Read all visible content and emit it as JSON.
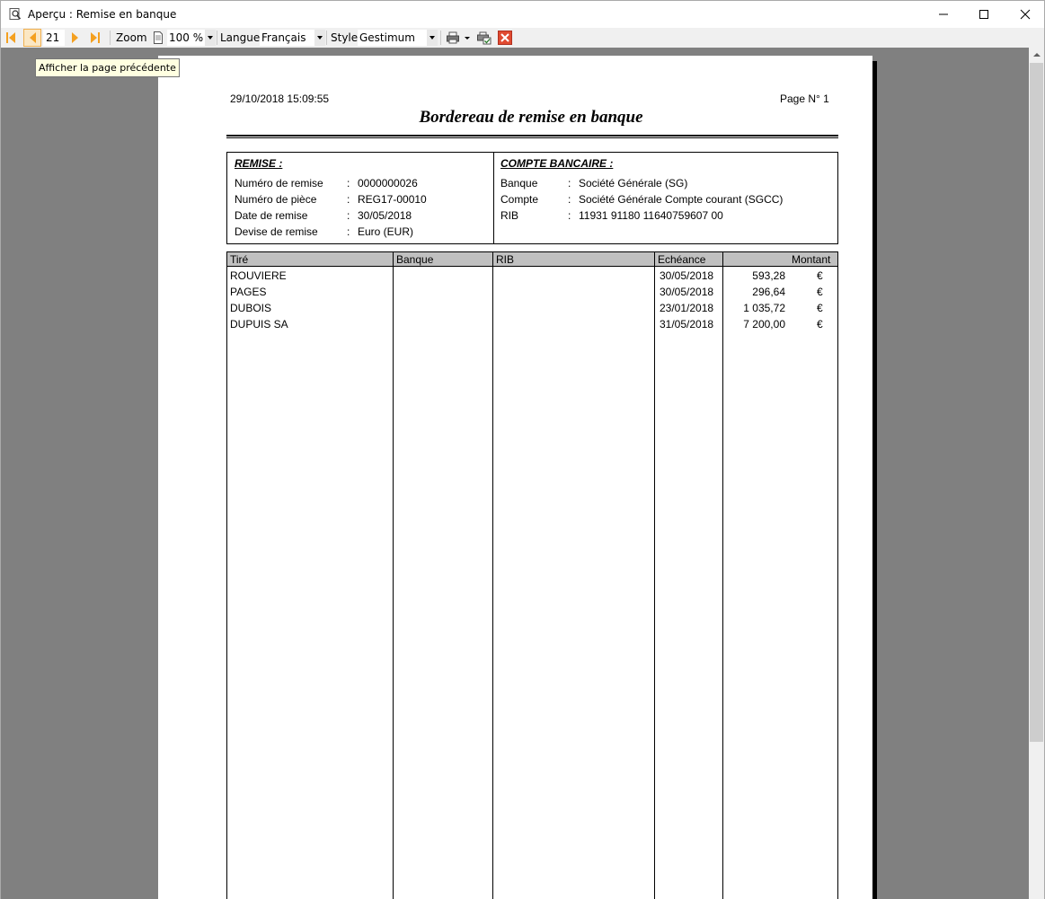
{
  "window": {
    "title": "Aperçu : Remise en banque",
    "tooltip": "Afficher la page précédente"
  },
  "toolbar": {
    "page_number": "21",
    "zoom_label": "Zoom",
    "zoom_value": "100 %",
    "language_label": "Langue",
    "language_value": "Français",
    "style_label": "Style",
    "style_value": "Gestimum"
  },
  "document": {
    "datetime": "29/10/2018 15:09:55",
    "page_label": "Page N° 1",
    "title": "Bordereau de remise en banque",
    "remise": {
      "heading": "REMISE :",
      "rows": [
        {
          "label": "Numéro de remise",
          "sep": ":",
          "value": "0000000026"
        },
        {
          "label": "Numéro de pièce",
          "sep": ":",
          "value": "REG17-00010"
        },
        {
          "label": "Date de remise",
          "sep": ":",
          "value": "30/05/2018"
        },
        {
          "label": "Devise de remise",
          "sep": ":",
          "value": "Euro (EUR)"
        }
      ]
    },
    "compte": {
      "heading": "COMPTE BANCAIRE :",
      "rows": [
        {
          "label": "Banque",
          "sep": ":",
          "value": "Société Générale (SG)"
        },
        {
          "label": "Compte",
          "sep": ":",
          "value": "Société Générale Compte courant (SGCC)"
        },
        {
          "label": "RIB",
          "sep": ":",
          "value": "11931 91180 11640759607 00"
        }
      ]
    },
    "table": {
      "columns": [
        "Tiré",
        "Banque",
        "RIB",
        "Echéance",
        "Montant"
      ],
      "rows": [
        {
          "tire": "ROUVIERE",
          "banque": "",
          "rib": "",
          "echeance": "30/05/2018",
          "montant": "593,28",
          "currency": "€"
        },
        {
          "tire": "PAGES",
          "banque": "",
          "rib": "",
          "echeance": "30/05/2018",
          "montant": "296,64",
          "currency": "€"
        },
        {
          "tire": "DUBOIS",
          "banque": "",
          "rib": "",
          "echeance": "23/01/2018",
          "montant": "1 035,72",
          "currency": "€"
        },
        {
          "tire": "DUPUIS SA",
          "banque": "",
          "rib": "",
          "echeance": "31/05/2018",
          "montant": "7 200,00",
          "currency": "€"
        }
      ]
    }
  },
  "colors": {
    "nav_arrow": "#f4a020",
    "table_header_bg": "#c0c0c0",
    "preview_bg": "#808080",
    "close_icon": "#e04a30"
  }
}
